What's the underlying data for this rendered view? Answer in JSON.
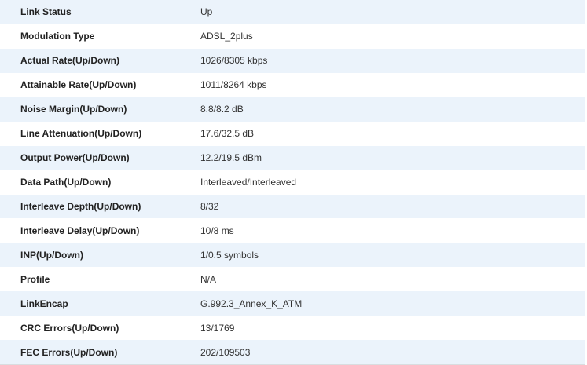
{
  "rows": [
    {
      "label": "Link Status",
      "value": "Up"
    },
    {
      "label": "Modulation Type",
      "value": "ADSL_2plus"
    },
    {
      "label": "Actual Rate(Up/Down)",
      "value": "1026/8305 kbps"
    },
    {
      "label": "Attainable Rate(Up/Down)",
      "value": "1011/8264 kbps"
    },
    {
      "label": "Noise Margin(Up/Down)",
      "value": "8.8/8.2 dB"
    },
    {
      "label": "Line Attenuation(Up/Down)",
      "value": "17.6/32.5 dB"
    },
    {
      "label": "Output Power(Up/Down)",
      "value": "12.2/19.5 dBm"
    },
    {
      "label": "Data Path(Up/Down)",
      "value": "Interleaved/Interleaved"
    },
    {
      "label": "Interleave Depth(Up/Down)",
      "value": "8/32"
    },
    {
      "label": "Interleave Delay(Up/Down)",
      "value": "10/8 ms"
    },
    {
      "label": "INP(Up/Down)",
      "value": "1/0.5 symbols"
    },
    {
      "label": "Profile",
      "value": "N/A"
    },
    {
      "label": "LinkEncap",
      "value": "G.992.3_Annex_K_ATM"
    },
    {
      "label": "CRC Errors(Up/Down)",
      "value": "13/1769"
    },
    {
      "label": "FEC Errors(Up/Down)",
      "value": "202/109503"
    }
  ]
}
